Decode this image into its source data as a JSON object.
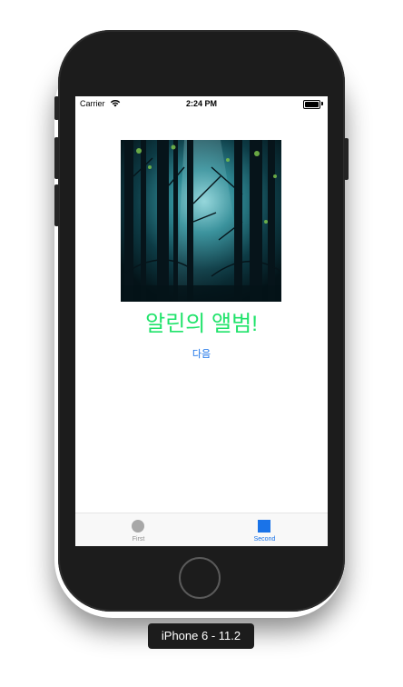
{
  "status_bar": {
    "carrier": "Carrier",
    "time": "2:24 PM",
    "wifi_icon": "wifi-icon",
    "battery_icon": "battery-full-icon"
  },
  "main": {
    "image": "forest-photo",
    "title": "알린의 앨범!",
    "title_color": "#1fe36a",
    "next_label": "다음",
    "accent_color": "#1a73e8"
  },
  "tab_bar": {
    "tabs": [
      {
        "label": "First",
        "icon": "circle-icon",
        "selected": false
      },
      {
        "label": "Second",
        "icon": "square-icon",
        "selected": true
      }
    ]
  },
  "device": {
    "caption": "iPhone 6 - 11.2"
  }
}
